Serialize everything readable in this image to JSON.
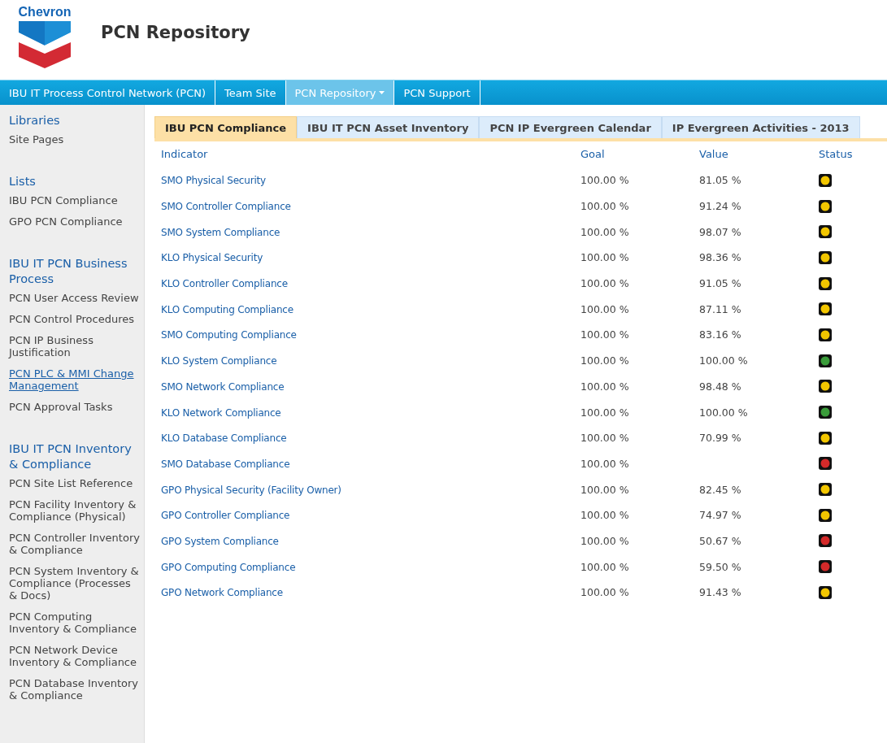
{
  "logo": {
    "text": "Chevron"
  },
  "site_title": "PCN Repository",
  "top_nav": [
    {
      "label": "IBU IT Process Control Network (PCN)",
      "selected": false,
      "has_menu": false
    },
    {
      "label": "Team Site",
      "selected": false,
      "has_menu": false
    },
    {
      "label": "PCN Repository",
      "selected": true,
      "has_menu": true
    },
    {
      "label": "PCN Support",
      "selected": false,
      "has_menu": false
    }
  ],
  "sidebar": [
    {
      "heading": "Libraries",
      "items": [
        {
          "label": "Site Pages",
          "hovered": false
        }
      ]
    },
    {
      "heading": "Lists",
      "items": [
        {
          "label": "IBU PCN Compliance",
          "hovered": false
        },
        {
          "label": "GPO PCN Compliance",
          "hovered": false
        }
      ]
    },
    {
      "heading": "IBU IT PCN Business Process",
      "items": [
        {
          "label": "PCN User Access Review",
          "hovered": false
        },
        {
          "label": "PCN Control Procedures",
          "hovered": false
        },
        {
          "label": "PCN IP Business Justification",
          "hovered": false
        },
        {
          "label": "PCN PLC & MMI Change Management",
          "hovered": true
        },
        {
          "label": "PCN Approval Tasks",
          "hovered": false
        }
      ]
    },
    {
      "heading": "IBU IT PCN Inventory & Compliance",
      "items": [
        {
          "label": "PCN Site List Reference",
          "hovered": false
        },
        {
          "label": "PCN Facility Inventory & Compliance (Physical)",
          "hovered": false
        },
        {
          "label": "PCN Controller Inventory & Compliance",
          "hovered": false
        },
        {
          "label": "PCN System Inventory & Compliance (Processes & Docs)",
          "hovered": false
        },
        {
          "label": "PCN Computing Inventory & Compliance",
          "hovered": false
        },
        {
          "label": "PCN Network Device Inventory & Compliance",
          "hovered": false
        },
        {
          "label": "PCN Database Inventory & Compliance",
          "hovered": false
        }
      ]
    }
  ],
  "tabs": [
    {
      "label": "IBU PCN Compliance",
      "selected": true
    },
    {
      "label": "IBU IT PCN Asset Inventory",
      "selected": false
    },
    {
      "label": "PCN IP Evergreen Calendar",
      "selected": false
    },
    {
      "label": "IP Evergreen Activities - 2013",
      "selected": false
    }
  ],
  "table": {
    "columns": [
      "Indicator",
      "Goal",
      "Value",
      "Status"
    ],
    "rows": [
      {
        "indicator": "SMO Physical Security",
        "goal": "100.00 %",
        "value": "81.05 %",
        "color": "#f2c600"
      },
      {
        "indicator": "SMO Controller Compliance",
        "goal": "100.00 %",
        "value": "91.24 %",
        "color": "#f2c600"
      },
      {
        "indicator": "SMO System Compliance",
        "goal": "100.00 %",
        "value": "98.07 %",
        "color": "#f2c600"
      },
      {
        "indicator": "KLO Physical Security",
        "goal": "100.00 %",
        "value": "98.36 %",
        "color": "#f2c600"
      },
      {
        "indicator": "KLO Controller Compliance",
        "goal": "100.00 %",
        "value": "91.05 %",
        "color": "#f2c600"
      },
      {
        "indicator": "KLO Computing Compliance",
        "goal": "100.00 %",
        "value": "87.11 %",
        "color": "#f2c600"
      },
      {
        "indicator": "SMO Computing Compliance",
        "goal": "100.00 %",
        "value": "83.16 %",
        "color": "#f2c600"
      },
      {
        "indicator": "KLO System Compliance",
        "goal": "100.00 %",
        "value": "100.00 %",
        "color": "#3a9c3a"
      },
      {
        "indicator": "SMO Network Compliance",
        "goal": "100.00 %",
        "value": "98.48 %",
        "color": "#f2c600"
      },
      {
        "indicator": "KLO Network Compliance",
        "goal": "100.00 %",
        "value": "100.00 %",
        "color": "#3a9c3a"
      },
      {
        "indicator": "KLO Database Compliance",
        "goal": "100.00 %",
        "value": "70.99 %",
        "color": "#f2c600"
      },
      {
        "indicator": "SMO Database Compliance",
        "goal": "100.00 %",
        "color": "#d42a2a"
      },
      {
        "indicator": "GPO Physical Security (Facility Owner)",
        "goal": "100.00 %",
        "value": "82.45 %",
        "color": "#f2c600"
      },
      {
        "indicator": "GPO Controller Compliance",
        "goal": "100.00 %",
        "value": "74.97 %",
        "color": "#f2c600"
      },
      {
        "indicator": "GPO System Compliance",
        "goal": "100.00 %",
        "value": "50.67 %",
        "color": "#d42a2a"
      },
      {
        "indicator": "GPO Computing Compliance",
        "goal": "100.00 %",
        "value": "59.50 %",
        "color": "#d42a2a"
      },
      {
        "indicator": "GPO Network Compliance",
        "goal": "100.00 %",
        "value": "91.43 %",
        "color": "#f2c600"
      }
    ]
  }
}
